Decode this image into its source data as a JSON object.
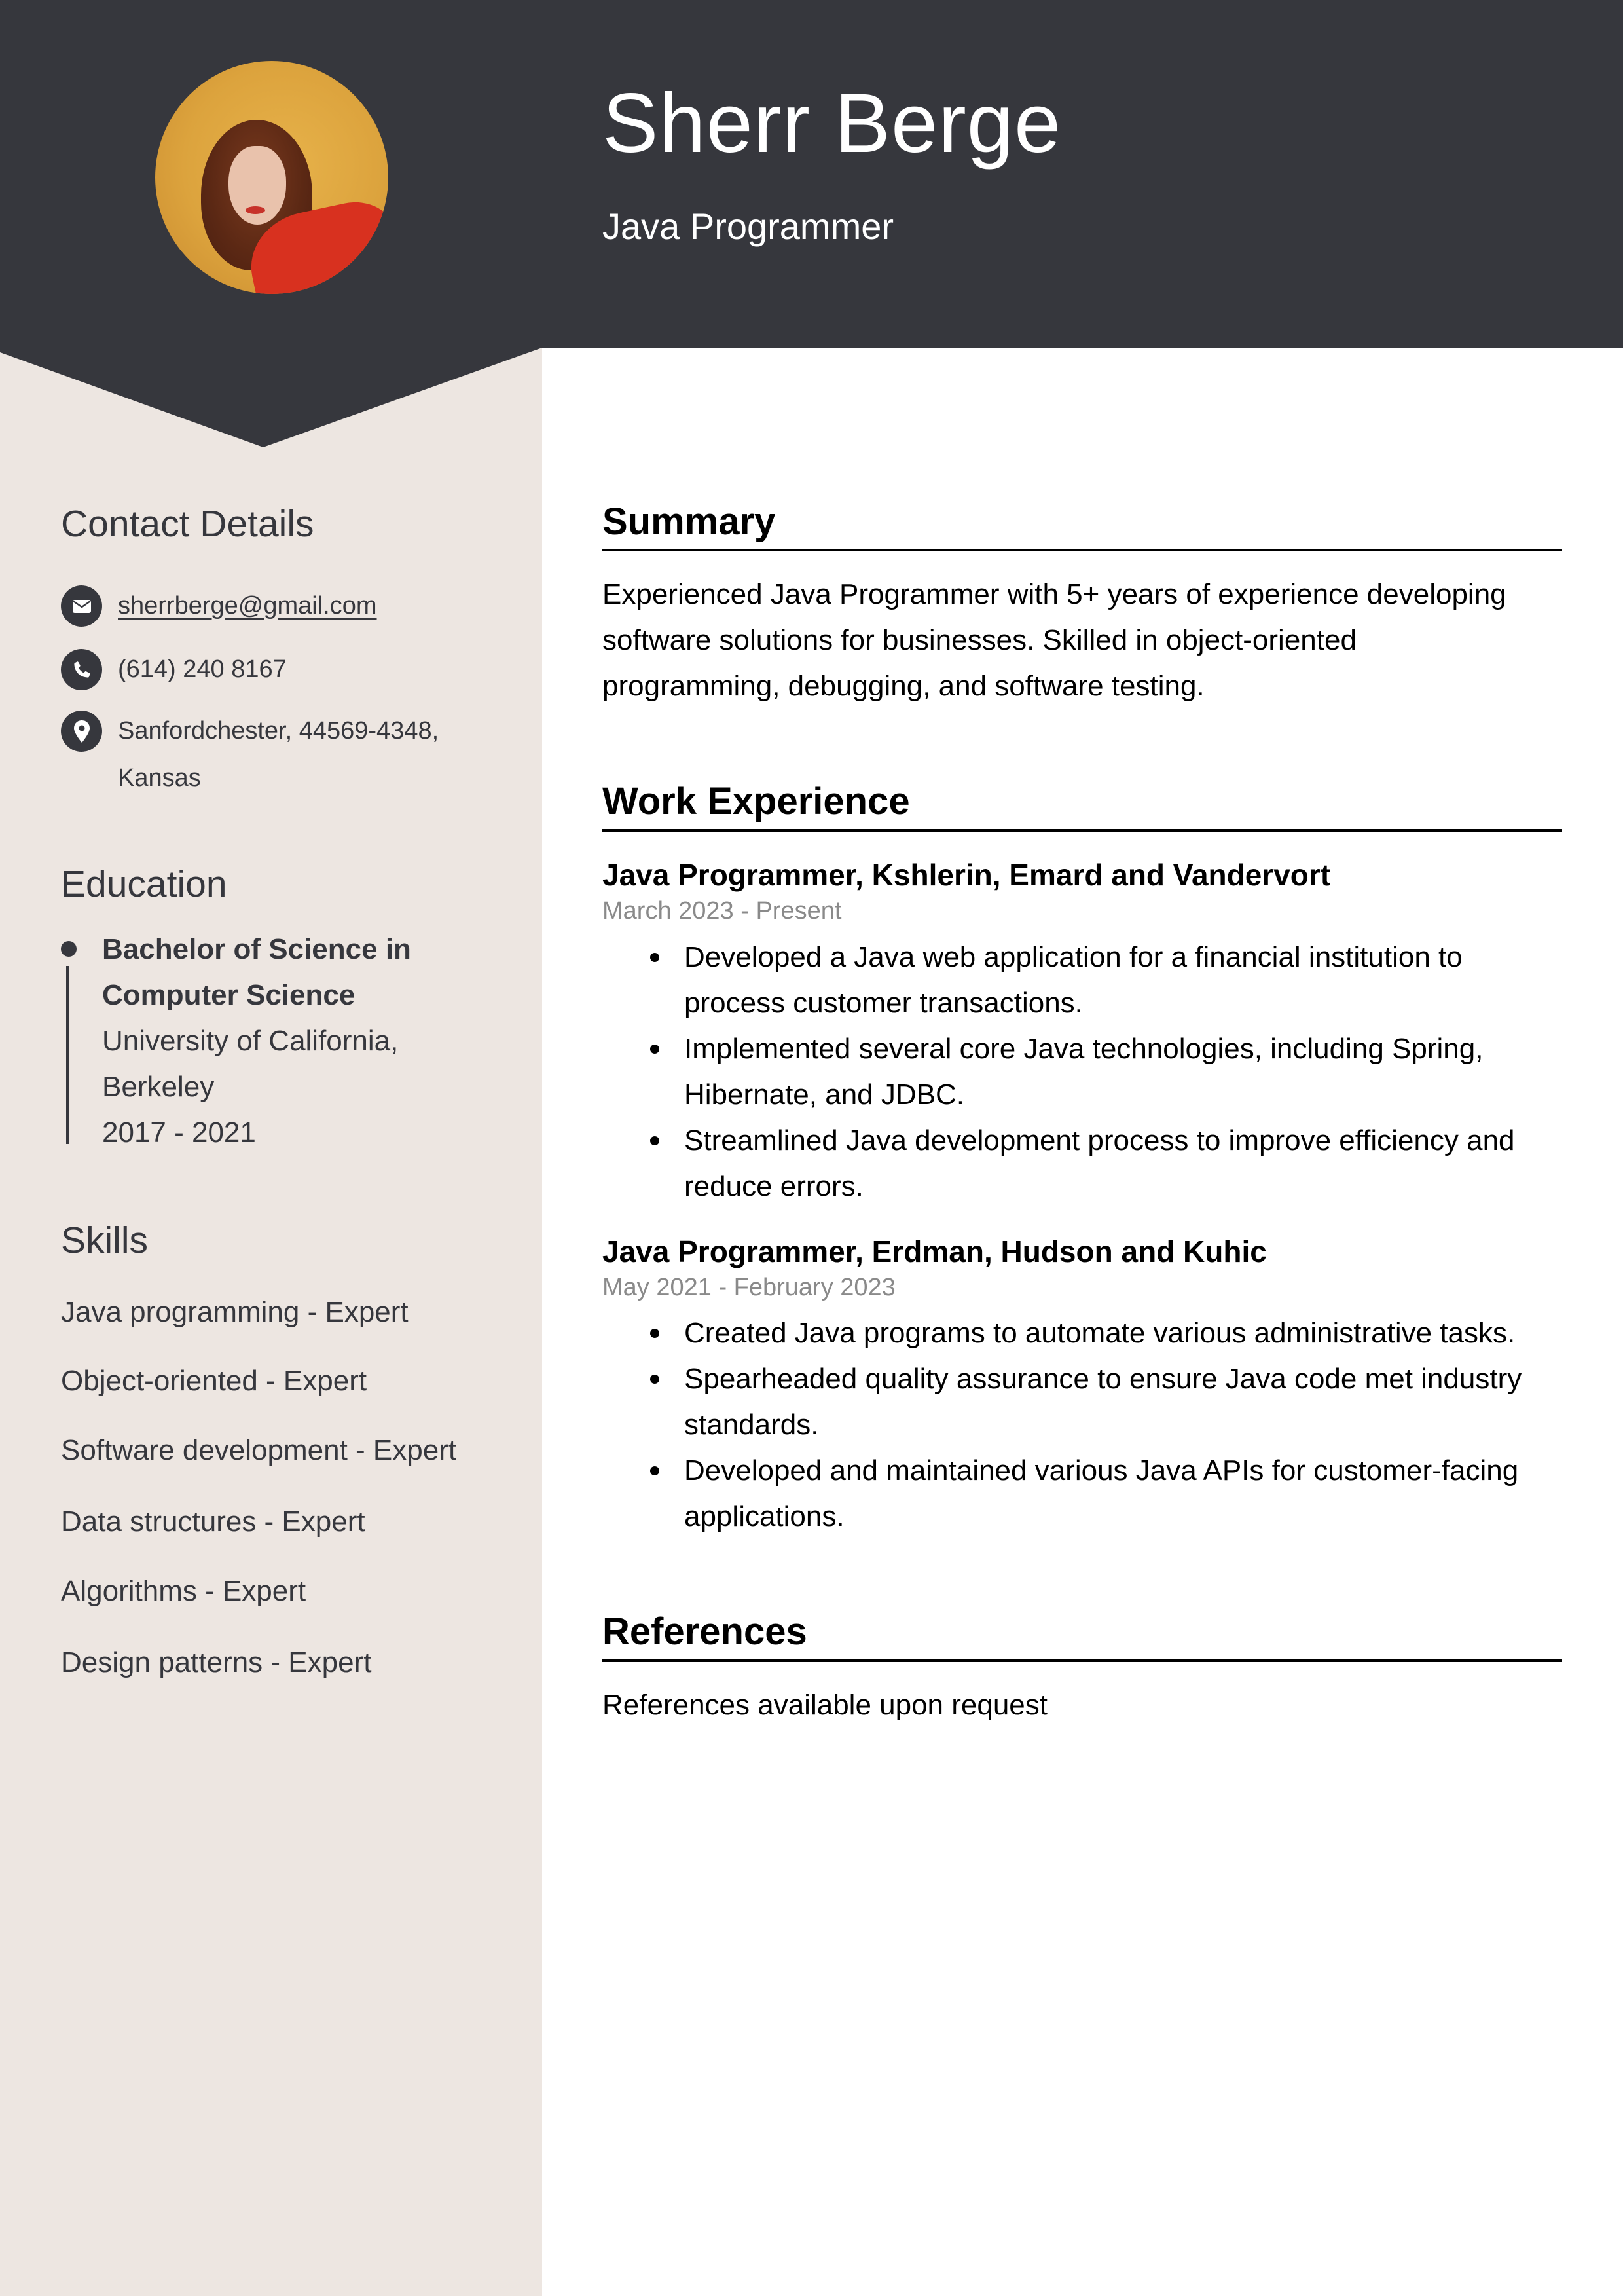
{
  "header": {
    "name": "Sherr Berge",
    "job_title": "Java Programmer",
    "photo_alt": "Portrait photo"
  },
  "colors": {
    "header_bg": "#36373d",
    "sidebar_bg": "#ede6e1",
    "date_gray": "#8a8a8a"
  },
  "sidebar": {
    "contact": {
      "heading": "Contact Details",
      "items": [
        {
          "icon": "envelope-icon",
          "text": "sherrberge@gmail.com",
          "is_link": true
        },
        {
          "icon": "phone-icon",
          "text": "(614) 240 8167"
        },
        {
          "icon": "location-pin-icon",
          "line1": "Sanfordchester, 44569-4348,",
          "line2": "Kansas"
        }
      ]
    },
    "education": {
      "heading": "Education",
      "entries": [
        {
          "degree_line1": "Bachelor of Science in",
          "degree_line2": "Computer Science",
          "school_line1": "University of California,",
          "school_line2": "Berkeley",
          "years": "2017 - 2021"
        }
      ]
    },
    "skills": {
      "heading": "Skills",
      "items": [
        "Java programming - Expert",
        "Object-oriented - Expert",
        "Software development - Expert",
        "Data structures - Expert",
        "Algorithms - Expert",
        "Design patterns - Expert"
      ]
    }
  },
  "main": {
    "summary": {
      "heading": "Summary",
      "lines": [
        "Experienced Java Programmer with 5+ years of experience developing",
        "software solutions for businesses. Skilled in object-oriented",
        "programming, debugging, and software testing."
      ]
    },
    "work_experience": {
      "heading": "Work Experience",
      "jobs": [
        {
          "title": "Java Programmer, Kshlerin, Emard and Vandervort",
          "dates": "March 2023 - Present",
          "bullets": [
            {
              "line1": "Developed a Java web application for a financial institution to",
              "line2": "process customer transactions."
            },
            {
              "line1": "Implemented several core Java technologies, including Spring,",
              "line2": "Hibernate, and JDBC."
            },
            {
              "line1": "Streamlined Java development process to improve efficiency and",
              "line2": "reduce errors."
            }
          ]
        },
        {
          "title": "Java Programmer, Erdman, Hudson and Kuhic",
          "dates": "May 2021 - February 2023",
          "bullets": [
            {
              "line1": "Created Java programs to automate various administrative tasks."
            },
            {
              "line1": "Spearheaded quality assurance to ensure Java code met industry",
              "line2": "standards."
            },
            {
              "line1": "Developed and maintained various Java APIs for customer-facing",
              "line2": "applications."
            }
          ]
        }
      ]
    },
    "references": {
      "heading": "References",
      "text": "References available upon request"
    }
  }
}
